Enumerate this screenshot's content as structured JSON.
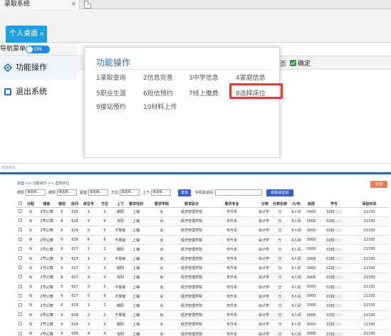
{
  "browser": {
    "tab_title": "录取系统",
    "tab_close": "×"
  },
  "app_tab": {
    "label": "个人桌面",
    "close": "×"
  },
  "sidebar": {
    "nav_toggle_label": "导航菜单",
    "switch_label": "ON",
    "items": [
      {
        "label": "功能操作",
        "icon": "gear-icon"
      },
      {
        "label": "退出系统",
        "icon": "exit-icon"
      }
    ]
  },
  "toolbar": {
    "page_label": "页",
    "confirm_label": "确定"
  },
  "popup": {
    "title": "功能操作",
    "items": [
      "1录取查询",
      "2信息完善",
      "3中学信息",
      "4家庭信息",
      "5职业生涯",
      "6短信预约",
      "7线上缴费",
      "8选择床位",
      "9接站预约",
      "10材料上传"
    ],
    "highlight_color": "#e53935"
  },
  "bottom": {
    "title": "选择床位",
    "breadcrumb": {
      "home": "桌面",
      "sep1": ">>",
      "mid": "功能操作",
      "sep2": ">>",
      "current": "选择床位"
    },
    "filters": {
      "building_label": "楼层:",
      "building_value": "请选择...",
      "floor_label": "楼层:",
      "floor_value": "请选择...",
      "room_label": "寝室:",
      "room_value": "请选择...",
      "direction_label": "方位:",
      "direction_value": "请选择...",
      "updown_label": "上下:",
      "updown_value": "请选择...",
      "query_button": "查询",
      "phone_label": "手机验证码:",
      "get_code_button": "获取验证码",
      "back_button": "返回"
    },
    "table": {
      "headers": [
        "",
        "分配",
        "楼栋",
        "楼层",
        "房间",
        "床位号",
        "方位",
        "上下",
        "要求性别",
        "要求学院",
        "要求层次",
        "要求专业",
        "分类",
        "分类名称",
        "元/年",
        "班团",
        "学号",
        "添加时间"
      ],
      "rows": [
        [
          "N",
          "2号公寓",
          "6",
          "626",
          "1",
          "3",
          "朝阳",
          "上铺",
          "女",
          "经济管理学院",
          "专升本",
          "会计学（税务方向）财务会计）",
          "分",
          "6人间",
          "3000",
          "02班",
          "21330",
          "2021/8/6 8:49:09"
        ],
        [
          "N",
          "2号公寓",
          "6",
          "626",
          "4",
          "4",
          "背阳",
          "上铺",
          "女",
          "经济管理学院",
          "专升本",
          "会计学（税务方向）财务会计）",
          "分",
          "6人间",
          "3000",
          "02班",
          "21330",
          "2021/8/6 8:49:09"
        ],
        [
          "N",
          "2号公寓",
          "6",
          "626",
          "5",
          "5",
          "不靠窗",
          "上铺",
          "女",
          "经济管理学院",
          "专升本",
          "会计学（税务方向）财务会计）",
          "分",
          "6人间",
          "3000",
          "02班",
          "21330",
          "2021/8/6 8:49:09"
        ],
        [
          "N",
          "2号公寓",
          "6",
          "626",
          "6",
          "6",
          "不靠窗",
          "上铺",
          "女",
          "经济管理学院",
          "专升本",
          "会计学（税务方向）财务会计）",
          "分",
          "6人间",
          "3000",
          "02班",
          "21330",
          "2021/8/6 8:49:09"
        ],
        [
          "N",
          "2号公寓",
          "6",
          "627",
          "1",
          "1",
          "朝阳",
          "上铺",
          "女",
          "经济管理学院",
          "专升本",
          "会计学（税务方向）财务会计）",
          "分",
          "6人间",
          "3000",
          "02班",
          "21330",
          "2021/8/6 8:49:09"
        ],
        [
          "N",
          "2号公寓",
          "6",
          "627",
          "1",
          "2",
          "不靠窗",
          "上铺",
          "女",
          "经济管理学院",
          "专升本",
          "会计学（税务方向）财务会计）",
          "分",
          "6人间",
          "3000",
          "02班",
          "21330",
          "2021/8/6 8:49:09"
        ],
        [
          "N",
          "2号公寓",
          "6",
          "627",
          "3",
          "3",
          "朝阳",
          "上铺",
          "女",
          "经济管理学院",
          "专升本",
          "会计学（税务方向）财务会计）",
          "分",
          "6人间",
          "3000",
          "02班",
          "21330",
          "2021/8/6 8:49:09"
        ],
        [
          "N",
          "2号公寓",
          "6",
          "627",
          "4",
          "4",
          "背阳",
          "上铺",
          "女",
          "经济管理学院",
          "专升本",
          "会计学（税务方向）财务会计）",
          "分",
          "6人间",
          "3000",
          "02班",
          "21330",
          "2021/8/6 8:49:09"
        ],
        [
          "N",
          "2号公寓",
          "6",
          "627",
          "5",
          "5",
          "不靠窗",
          "上铺",
          "女",
          "经济管理学院",
          "专升本",
          "会计学（税务方向）财务会计）",
          "分",
          "6人间",
          "3000",
          "02班",
          "21330",
          "2021/8/6 8:49:09"
        ],
        [
          "N",
          "2号公寓",
          "6",
          "627",
          "6",
          "6",
          "不靠窗",
          "上铺",
          "女",
          "经济管理学院",
          "专升本",
          "会计学（税务方向）财务会计）",
          "分",
          "6人间",
          "3000",
          "02班",
          "21330",
          "2021/8/6 8:49:09"
        ],
        [
          "N",
          "2号公寓",
          "6",
          "628",
          "1",
          "1",
          "朝阳",
          "上铺",
          "女",
          "经济管理学院",
          "专升本",
          "会计学（税务方向）财务会计）",
          "分",
          "6人间",
          "3000",
          "02班",
          "21330",
          "2021/8/6 8:49:09"
        ],
        [
          "N",
          "2号公寓",
          "6",
          "628",
          "2",
          "2",
          "不靠窗",
          "上铺",
          "女",
          "经济管理学院",
          "专升本",
          "会计学（税务方向）财务会计）",
          "分",
          "6人间",
          "3000",
          "02班",
          "21330",
          "2021/8/6 8:49:09"
        ],
        [
          "N",
          "2号公寓",
          "6",
          "628",
          "3",
          "3",
          "朝阳",
          "上铺",
          "女",
          "经济管理学院",
          "专升本",
          "会计学（税务方向）财务会计）",
          "分",
          "6人间",
          "3000",
          "02班",
          "21330",
          "2021/8/6 8:49:09"
        ],
        [
          "N",
          "2号公寓",
          "6",
          "628",
          "4",
          "4",
          "背阳",
          "上铺",
          "女",
          "经济管理学院",
          "专升本",
          "会计学（税务方向）财务会计）",
          "分",
          "6人间",
          "3000",
          "02班",
          "21330",
          "2021/8/6 8:49:09"
        ],
        [
          "N",
          "2号公寓",
          "6",
          "628",
          "5",
          "5",
          "不靠窗",
          "上铺",
          "女",
          "经济管理学院",
          "专升本",
          "会计学（税务方向）财务会计）",
          "分",
          "6人间",
          "3000",
          "02班",
          "21330",
          "2021/8/6 8:49:09"
        ]
      ]
    }
  }
}
